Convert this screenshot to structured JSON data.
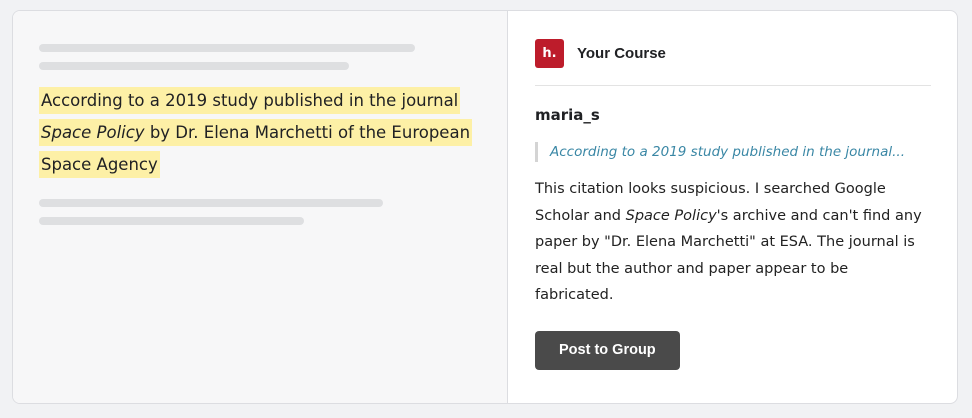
{
  "document": {
    "highlight_line1": "According to a 2019 study published in the journal",
    "highlight_journal": "Space Policy",
    "highlight_rest": " by Dr. Elena Marchetti of the European Space Agency"
  },
  "sidebar": {
    "logo_text": "h.",
    "course_title": "Your Course",
    "annotation": {
      "username": "maria_s",
      "quote": "According to a 2019 study published in the journal...",
      "comment_part1": "This citation looks suspicious. I searched Google Scholar and ",
      "comment_italic": "Space Policy",
      "comment_part2": "'s archive and can't find any paper by \"Dr. Elena Marchetti\" at ESA. The journal is real but the author and paper appear to be fabricated."
    },
    "post_button_label": "Post to Group"
  },
  "colors": {
    "brand": "#bd1c2b",
    "highlight": "#fdf0a6",
    "quote_text": "#3a87a5",
    "button": "#4a4a4a"
  }
}
